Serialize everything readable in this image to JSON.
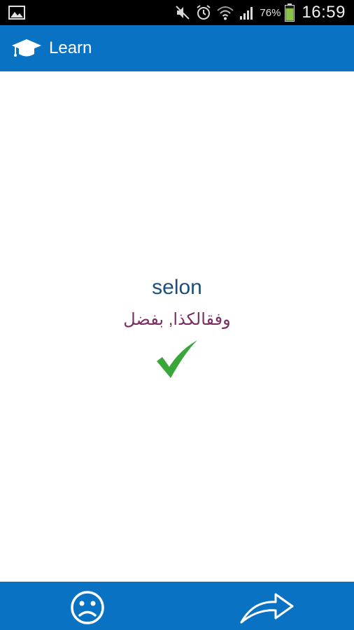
{
  "status_bar": {
    "battery_percent": "76%",
    "time": "16:59",
    "icons": [
      "gallery-notification-icon",
      "mute-icon",
      "alarm-icon",
      "wifi-icon",
      "signal-icon",
      "battery-icon"
    ]
  },
  "app_bar": {
    "title": "Learn",
    "icon": "graduation-cap-icon"
  },
  "card": {
    "word": "selon",
    "translation": "وفقالكذا, بفضل",
    "result_icon": "checkmark-icon"
  },
  "bottom_bar": {
    "icons": [
      "sad-face-icon",
      "next-arrow-icon"
    ]
  },
  "colors": {
    "primary": "#0a72c2",
    "word": "#1c4f7c",
    "translation": "#7a2f5e",
    "check": "#3aa63a"
  }
}
